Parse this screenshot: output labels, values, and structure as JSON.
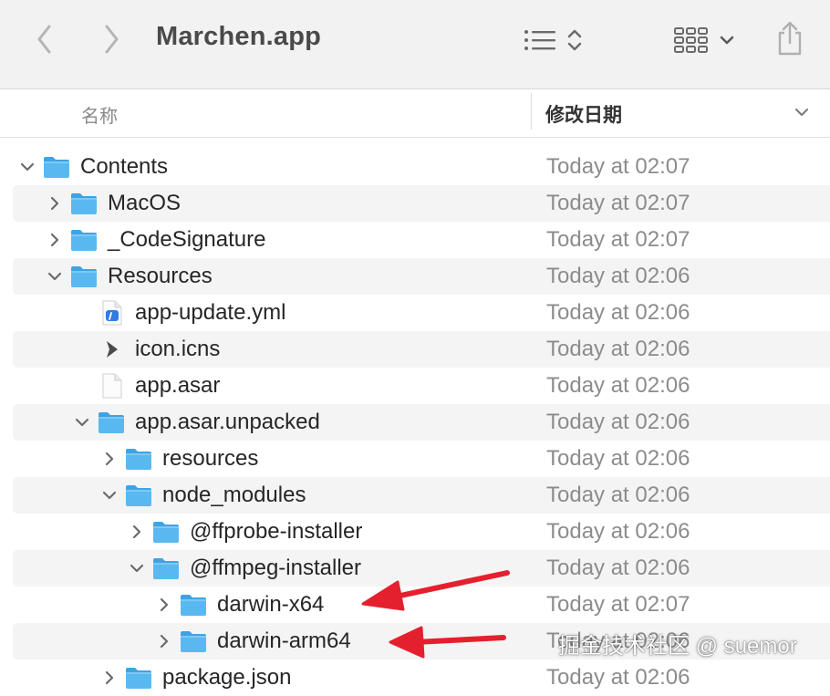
{
  "window": {
    "title": "Marchen.app"
  },
  "toolbar": {
    "back_icon": "chevron-left-icon",
    "forward_icon": "chevron-right-icon",
    "view_list_icon": "list-view-icon",
    "group_icon": "grid-view-icon",
    "share_icon": "share-icon"
  },
  "header": {
    "name": "名称",
    "date_modified": "修改日期"
  },
  "rows": [
    {
      "name": "Contents",
      "date": "Today at 02:07",
      "kind": "folder",
      "level": 0,
      "expanded": true
    },
    {
      "name": "MacOS",
      "date": "Today at 02:07",
      "kind": "folder",
      "level": 1,
      "expanded": false
    },
    {
      "name": "_CodeSignature",
      "date": "Today at 02:07",
      "kind": "folder",
      "level": 1,
      "expanded": false
    },
    {
      "name": "Resources",
      "date": "Today at 02:06",
      "kind": "folder",
      "level": 1,
      "expanded": true
    },
    {
      "name": "app-update.yml",
      "date": "Today at 02:06",
      "kind": "yml",
      "level": 2
    },
    {
      "name": "icon.icns",
      "date": "Today at 02:06",
      "kind": "icns",
      "level": 2
    },
    {
      "name": "app.asar",
      "date": "Today at 02:06",
      "kind": "file",
      "level": 2
    },
    {
      "name": "app.asar.unpacked",
      "date": "Today at 02:06",
      "kind": "folder",
      "level": 2,
      "expanded": true
    },
    {
      "name": "resources",
      "date": "Today at 02:06",
      "kind": "folder",
      "level": 3,
      "expanded": false
    },
    {
      "name": "node_modules",
      "date": "Today at 02:06",
      "kind": "folder",
      "level": 3,
      "expanded": true
    },
    {
      "name": "@ffprobe-installer",
      "date": "Today at 02:06",
      "kind": "folder",
      "level": 4,
      "expanded": false
    },
    {
      "name": "@ffmpeg-installer",
      "date": "Today at 02:06",
      "kind": "folder",
      "level": 4,
      "expanded": true
    },
    {
      "name": "darwin-x64",
      "date": "Today at 02:07",
      "kind": "folder",
      "level": 5,
      "expanded": false
    },
    {
      "name": "darwin-arm64",
      "date": "Today at 02:06",
      "kind": "folder",
      "level": 5,
      "expanded": false
    },
    {
      "name": "package.json",
      "date": "Today at 02:06",
      "kind": "folder",
      "level": 3,
      "expanded": false
    }
  ],
  "watermark": "掘金技术社区 @ suemor",
  "colors": {
    "folder": "#5ab8f0",
    "folder_dark": "#3fa3e3",
    "arrow": "#e5202e",
    "alt_row": "#f4f4f4"
  }
}
